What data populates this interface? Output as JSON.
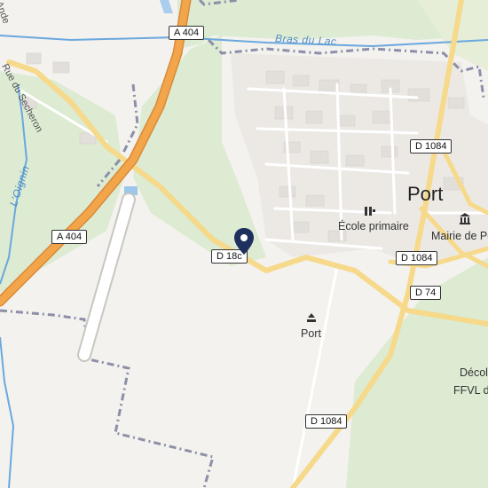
{
  "map": {
    "roads": {
      "a404_north": "A 404",
      "a404_west": "A 404",
      "d1084_town": "D 1084",
      "d1084_mid": "D 1084",
      "d1084_south": "D 1084",
      "d74": "D 74",
      "d18c": "D 18c"
    },
    "places": {
      "town": "Port",
      "school": "École primaire",
      "townhall": "Mairie de Po",
      "port": "Port",
      "paragliding_1": "Décol",
      "paragliding_2": "FFVL d"
    },
    "water": {
      "bras_du_lac": "Bras du Lac",
      "oignin": "L'Oignin"
    },
    "streets": {
      "rue_secheron": "Rue du Secheron",
      "top_partial": "Ande"
    },
    "colors": {
      "land": "#f4f2ee",
      "green": "#dcebd2",
      "highway": "#f3a54a",
      "road": "#f6d98a",
      "water": "#6aa8de",
      "boundary": "#8d8fa8",
      "pin": "#1f2f5e"
    }
  }
}
